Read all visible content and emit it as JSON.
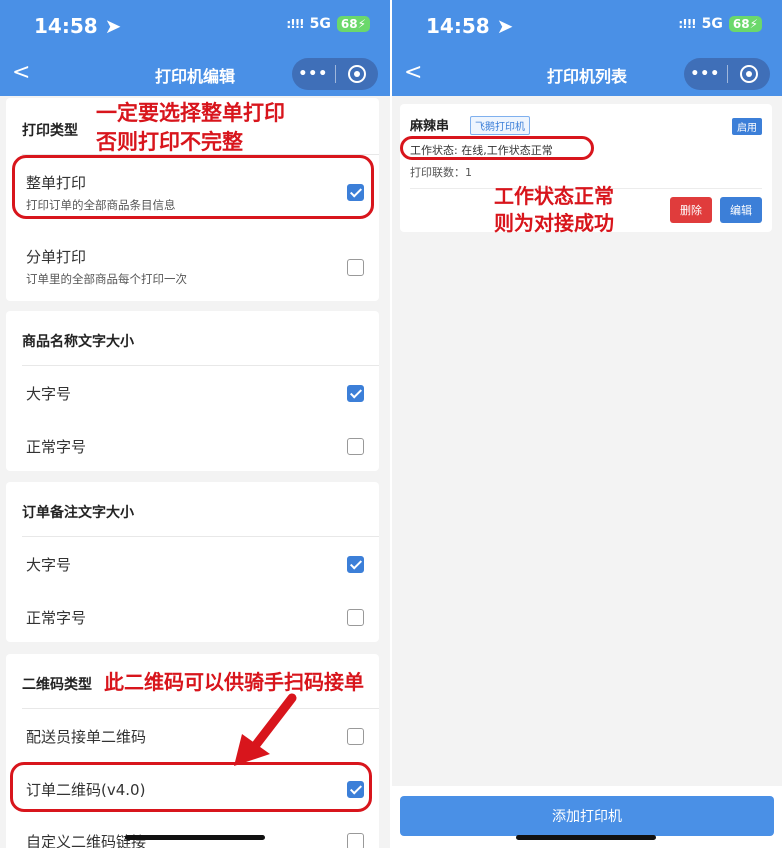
{
  "left": {
    "status": {
      "time": "14:58 ➤",
      "signal": ":!!!",
      "network": "5G",
      "battery": "68⚡"
    },
    "nav": {
      "back": "<",
      "title": "打印机编辑",
      "more": "•••"
    },
    "print_type": {
      "title": "打印类型",
      "options": [
        {
          "label": "整单打印",
          "desc": "打印订单的全部商品条目信息",
          "checked": true
        },
        {
          "label": "分单打印",
          "desc": "订单里的全部商品每个打印一次",
          "checked": false
        }
      ]
    },
    "name_size": {
      "title": "商品名称文字大小",
      "options": [
        {
          "label": "大字号",
          "checked": true
        },
        {
          "label": "正常字号",
          "checked": false
        }
      ]
    },
    "remark_size": {
      "title": "订单备注文字大小",
      "options": [
        {
          "label": "大字号",
          "checked": true
        },
        {
          "label": "正常字号",
          "checked": false
        }
      ]
    },
    "qr_type": {
      "title": "二维码类型",
      "options": [
        {
          "label": "配送员接单二维码",
          "checked": false
        },
        {
          "label": "订单二维码(v4.0)",
          "checked": true
        },
        {
          "label": "自定义二维码链接",
          "checked": false
        }
      ]
    },
    "annotations": {
      "top_line1": "一定要选择整单打印",
      "top_line2": "否则打印不完整",
      "qr_note": "此二维码可以供骑手扫码接单"
    }
  },
  "right": {
    "status": {
      "time": "14:58 ➤",
      "signal": ":!!!",
      "network": "5G",
      "battery": "68⚡"
    },
    "nav": {
      "back": "<",
      "title": "打印机列表",
      "more": "•••"
    },
    "printer": {
      "name": "麻辣串",
      "tag": "飞鹅打印机",
      "enable": "启用",
      "status": "工作状态: 在线,工作状态正常",
      "copies": "打印联数：1",
      "delete": "删除",
      "edit": "编辑"
    },
    "add_button": "添加打印机",
    "annotations": {
      "line1": "工作状态正常",
      "line2": "则为对接成功"
    }
  },
  "colors": {
    "accent": "#4a90e6",
    "annotation": "#d8151c",
    "delete": "#e03c3c"
  }
}
